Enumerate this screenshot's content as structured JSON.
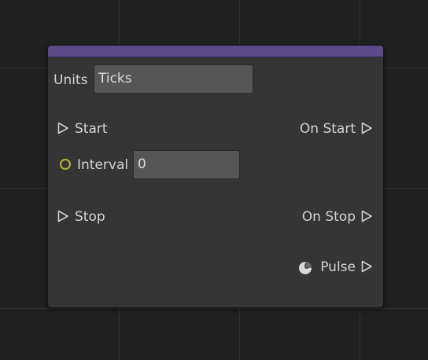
{
  "node": {
    "header_color": "#5b4a8a",
    "units": {
      "label": "Units",
      "value": "Ticks"
    },
    "start": {
      "input_label": "Start",
      "output_label": "On Start"
    },
    "interval": {
      "label": "Interval",
      "value": "0"
    },
    "stop": {
      "input_label": "Stop",
      "output_label": "On Stop"
    },
    "pulse": {
      "output_label": "Pulse",
      "icon": "clock-icon"
    }
  }
}
